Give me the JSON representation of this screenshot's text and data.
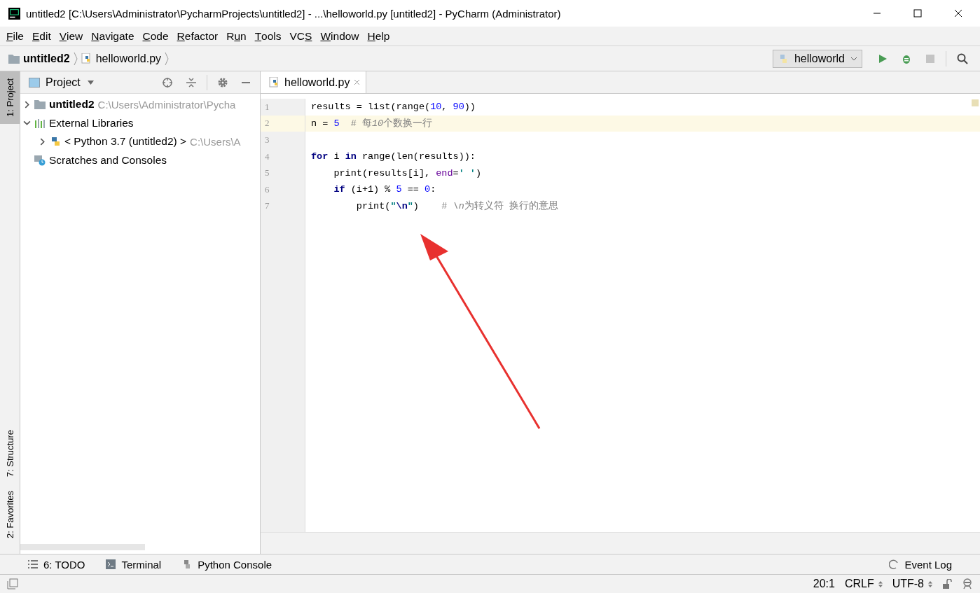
{
  "window": {
    "title": "untitled2 [C:\\Users\\Administrator\\PycharmProjects\\untitled2] - ...\\helloworld.py [untitled2] - PyCharm (Administrator)"
  },
  "menu": [
    {
      "key": "F",
      "post": "ile"
    },
    {
      "key": "E",
      "post": "dit"
    },
    {
      "key": "V",
      "post": "iew"
    },
    {
      "key": "N",
      "post": "avigate"
    },
    {
      "key": "C",
      "post": "ode"
    },
    {
      "key": "R",
      "post": "efactor"
    },
    {
      "pre": "R",
      "key": "u",
      "post": "n"
    },
    {
      "key": "T",
      "post": "ools"
    },
    {
      "pre": "VC",
      "key": "S"
    },
    {
      "key": "W",
      "post": "indow"
    },
    {
      "key": "H",
      "post": "elp"
    }
  ],
  "breadcrumbs": [
    {
      "label": "untitled2",
      "kind": "folder"
    },
    {
      "label": "helloworld.py",
      "kind": "python"
    }
  ],
  "run_config": {
    "label": "helloworld"
  },
  "left_stripe": {
    "top": [
      {
        "label": "1: Project",
        "selected": true
      }
    ],
    "bottom": [
      {
        "label": "7: Structure",
        "selected": false
      },
      {
        "label": "2: Favorites",
        "selected": false
      }
    ]
  },
  "project_panel": {
    "title": "Project",
    "tree": [
      {
        "label": "untitled2",
        "hint": "C:\\Users\\Administrator\\Pycha",
        "kind": "folder",
        "expanded": false
      },
      {
        "label": "External Libraries",
        "kind": "libraries",
        "expanded": true,
        "children": [
          {
            "label": "< Python 3.7 (untitled2) >",
            "hint": "C:\\Users\\A",
            "kind": "python",
            "expanded": false
          }
        ]
      },
      {
        "label": "Scratches and Consoles",
        "kind": "scratches"
      }
    ]
  },
  "editor": {
    "tabs": [
      {
        "label": "helloworld.py",
        "selected": true
      }
    ],
    "lines": [
      {
        "number": "1",
        "selected": false,
        "tokens": [
          {
            "text": "results = list(range(",
            "kind": "plain"
          },
          {
            "text": "10",
            "kind": "number"
          },
          {
            "text": ", ",
            "kind": "plain"
          },
          {
            "text": "90",
            "kind": "number"
          },
          {
            "text": "))",
            "kind": "plain"
          }
        ]
      },
      {
        "number": "2",
        "selected": true,
        "tokens": [
          {
            "text": "n = ",
            "kind": "plain"
          },
          {
            "text": "5",
            "kind": "number"
          },
          {
            "text": "  # 每",
            "kind": "comment"
          },
          {
            "text": "10",
            "kind": "comment_italic"
          },
          {
            "text": "个数换一行",
            "kind": "comment"
          }
        ]
      },
      {
        "number": "3",
        "selected": false
      },
      {
        "number": "4",
        "selected": false,
        "tokens": [
          {
            "text": "for",
            "kind": "keyword"
          },
          {
            "text": " i ",
            "kind": "plain"
          },
          {
            "text": "in",
            "kind": "keyword"
          },
          {
            "text": " range(len(results)):",
            "kind": "plain"
          }
        ]
      },
      {
        "number": "5",
        "selected": false,
        "tokens": [
          {
            "text": "    print(results[i], ",
            "kind": "plain"
          },
          {
            "text": "end",
            "kind": "param"
          },
          {
            "text": "=",
            "kind": "plain"
          },
          {
            "text": "' '",
            "kind": "string"
          },
          {
            "text": ")",
            "kind": "plain"
          }
        ]
      },
      {
        "number": "6",
        "selected": false,
        "tokens": [
          {
            "text": "    if",
            "kind": "keyword"
          },
          {
            "text": " (i+1) % ",
            "kind": "plain"
          },
          {
            "text": "5",
            "kind": "number"
          },
          {
            "text": " == ",
            "kind": "plain"
          },
          {
            "text": "0",
            "kind": "number"
          },
          {
            "text": ":",
            "kind": "plain"
          }
        ]
      },
      {
        "number": "7",
        "selected": false,
        "tokens": [
          {
            "text": "        print(",
            "kind": "plain"
          },
          {
            "text": "\"",
            "kind": "string"
          },
          {
            "text": "\\n",
            "kind": "escape"
          },
          {
            "text": "\"",
            "kind": "string"
          },
          {
            "text": ")    ",
            "kind": "plain"
          },
          {
            "text": "# ",
            "kind": "comment"
          },
          {
            "text": "\\n",
            "kind": "comment_italic"
          },
          {
            "text": "为转义符 换行的意思",
            "kind": "comment"
          }
        ]
      }
    ]
  },
  "tool_windows": [
    {
      "label": "6: TODO",
      "kind": "todo"
    },
    {
      "label": "Terminal",
      "kind": "terminal"
    },
    {
      "label": "Python Console",
      "kind": "python"
    },
    {
      "label": "Event Log",
      "kind": "eventlog"
    }
  ],
  "status_bar": {
    "position": "20:1",
    "line_separator": "CRLF",
    "encoding": "UTF-8"
  }
}
